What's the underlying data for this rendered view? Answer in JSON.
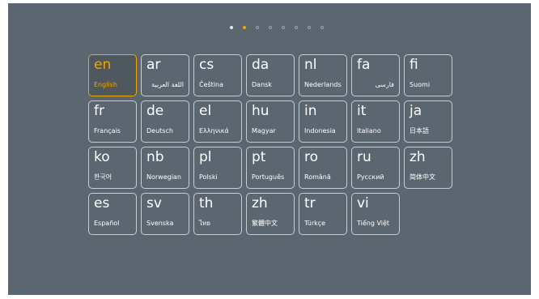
{
  "pager": {
    "dots": [
      "filled",
      "active",
      "hollow",
      "hollow",
      "hollow",
      "hollow",
      "hollow",
      "hollow"
    ]
  },
  "languages": [
    {
      "code": "en",
      "name": "English",
      "selected": true
    },
    {
      "code": "ar",
      "name": "اللغة العربية",
      "rtl": true
    },
    {
      "code": "cs",
      "name": "Čeština"
    },
    {
      "code": "da",
      "name": "Dansk"
    },
    {
      "code": "nl",
      "name": "Nederlands"
    },
    {
      "code": "fa",
      "name": "فارسی",
      "rtl": true
    },
    {
      "code": "fi",
      "name": "Suomi"
    },
    {
      "code": "fr",
      "name": "Français"
    },
    {
      "code": "de",
      "name": "Deutsch"
    },
    {
      "code": "el",
      "name": "Ελληνικά"
    },
    {
      "code": "hu",
      "name": "Magyar"
    },
    {
      "code": "in",
      "name": "Indonesia"
    },
    {
      "code": "it",
      "name": "Italiano"
    },
    {
      "code": "ja",
      "name": "日本語"
    },
    {
      "code": "ko",
      "name": "한국어"
    },
    {
      "code": "nb",
      "name": "Norwegian"
    },
    {
      "code": "pl",
      "name": "Polski"
    },
    {
      "code": "pt",
      "name": "Português"
    },
    {
      "code": "ro",
      "name": "Română"
    },
    {
      "code": "ru",
      "name": "Русский"
    },
    {
      "code": "zh",
      "name": "简体中文"
    },
    {
      "code": "es",
      "name": "Español"
    },
    {
      "code": "sv",
      "name": "Svenska"
    },
    {
      "code": "th",
      "name": "ไทย"
    },
    {
      "code": "zh",
      "name": "繁體中文"
    },
    {
      "code": "tr",
      "name": "Türkçe"
    },
    {
      "code": "vi",
      "name": "Tiếng Việt"
    }
  ]
}
